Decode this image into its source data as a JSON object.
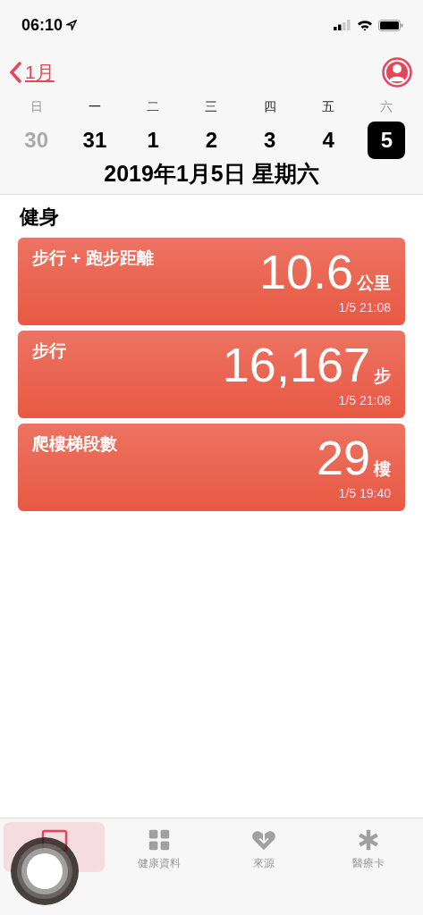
{
  "status_bar": {
    "time": "06:10"
  },
  "nav": {
    "back_label": "1月"
  },
  "week": {
    "weekdays": [
      {
        "label": "日",
        "weekend": true
      },
      {
        "label": "一",
        "weekend": false
      },
      {
        "label": "二",
        "weekend": false
      },
      {
        "label": "三",
        "weekend": false
      },
      {
        "label": "四",
        "weekend": false
      },
      {
        "label": "五",
        "weekend": false
      },
      {
        "label": "六",
        "weekend": true
      }
    ],
    "days": [
      {
        "label": "30",
        "other_month": true,
        "selected": false
      },
      {
        "label": "31",
        "other_month": false,
        "selected": false
      },
      {
        "label": "1",
        "other_month": false,
        "selected": false
      },
      {
        "label": "2",
        "other_month": false,
        "selected": false
      },
      {
        "label": "3",
        "other_month": false,
        "selected": false
      },
      {
        "label": "4",
        "other_month": false,
        "selected": false
      },
      {
        "label": "5",
        "other_month": false,
        "selected": true
      }
    ],
    "date_title": "2019年1月5日 星期六"
  },
  "section": {
    "title": "健身",
    "cards": [
      {
        "label": "步行 + 跑步距離",
        "value": "10.6",
        "unit": "公里",
        "time": "1/5 21:08"
      },
      {
        "label": "步行",
        "value": "16,167",
        "unit": "步",
        "time": "1/5 21:08"
      },
      {
        "label": "爬樓梯段數",
        "value": "29",
        "unit": "樓",
        "time": "1/5 19:40"
      }
    ]
  },
  "tab_bar": [
    {
      "kind": "today",
      "selected": true
    },
    {
      "kind": "grid",
      "label": "健康資料",
      "selected": false
    },
    {
      "kind": "heart",
      "label": "來源",
      "selected": false
    },
    {
      "kind": "asterisk",
      "label": "醫療卡",
      "selected": false
    }
  ]
}
